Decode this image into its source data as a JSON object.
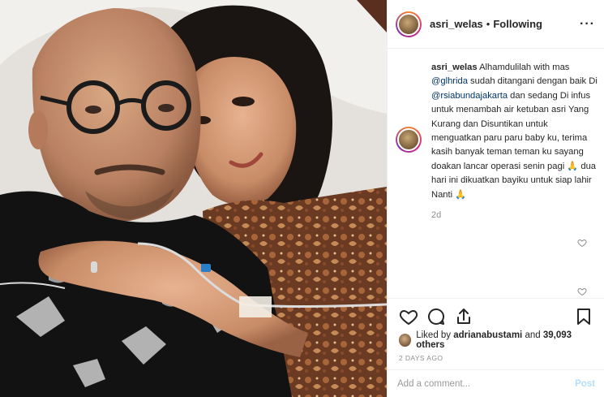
{
  "header": {
    "username": "asri_welas",
    "separator": "•",
    "follow_status": "Following",
    "more_icon": "more-horizontal-icon"
  },
  "caption": {
    "username": "asri_welas",
    "text_1": " Alhamdulilah with mas ",
    "mention_1": "@glhrida",
    "text_2": " sudah ditangani dengan baik Di ",
    "mention_2": "@rsiabundajakarta",
    "text_3": " dan sedang Di infus untuk menambah air ketuban asri Yang Kurang dan Disuntikan untuk menguatkan paru paru baby ku, terima kasih banyak teman teman ku sayang doakan lancar operasi senin pagi 🙏 dua hari ini dikuatkan bayiku untuk siap lahir Nanti 🙏",
    "time": "2d"
  },
  "actions": {
    "like_icon": "heart-icon",
    "comment_icon": "comment-icon",
    "share_icon": "share-icon",
    "save_icon": "bookmark-icon"
  },
  "likes": {
    "prefix": "Liked by ",
    "user": "adrianabustami",
    "middle": " and ",
    "count": "39,093 others"
  },
  "date": "2 DAYS AGO",
  "comment_box": {
    "placeholder": "Add a comment...",
    "post_label": "Post"
  },
  "colors": {
    "link": "#003569",
    "muted": "#8e8e8e",
    "post_disabled": "#b2dffc"
  }
}
